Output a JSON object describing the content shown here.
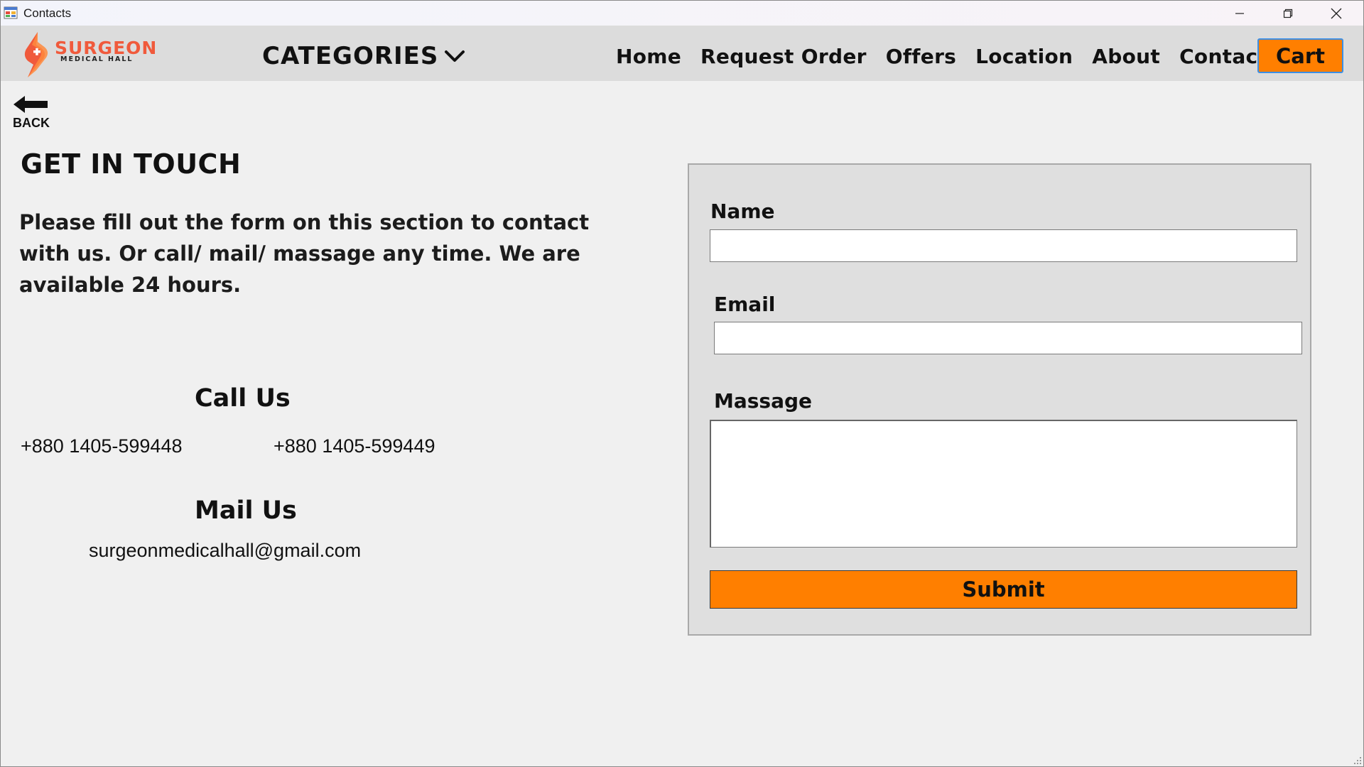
{
  "window": {
    "title": "Contacts"
  },
  "logo": {
    "name": "SURGEON",
    "tagline": "MEDICAL HALL"
  },
  "nav": {
    "categories_label": "CATEGORIES",
    "links": [
      "Home",
      "Request Order",
      "Offers",
      "Location",
      "About",
      "Contacts"
    ],
    "cart_label": "Cart"
  },
  "back": {
    "label": "BACK"
  },
  "contact": {
    "heading": "GET IN TOUCH",
    "intro": "Please fill out the form on this section to contact with us. Or call/ mail/ massage any time. We are available 24 hours.",
    "call_heading": "Call Us",
    "phones": [
      "+880 1405-599448",
      "+880 1405-599449"
    ],
    "mail_heading": "Mail Us",
    "email": "surgeonmedicalhall@gmail.com"
  },
  "form": {
    "name_label": "Name",
    "name_value": "",
    "email_label": "Email",
    "email_value": "",
    "message_label": "Massage",
    "message_value": "",
    "submit_label": "Submit"
  },
  "colors": {
    "accent": "#ff7f00",
    "logo_red": "#f05a3c",
    "nav_bg": "#dcdcdc",
    "page_bg": "#f0f0f0",
    "focus_border": "#3b8fe6"
  }
}
